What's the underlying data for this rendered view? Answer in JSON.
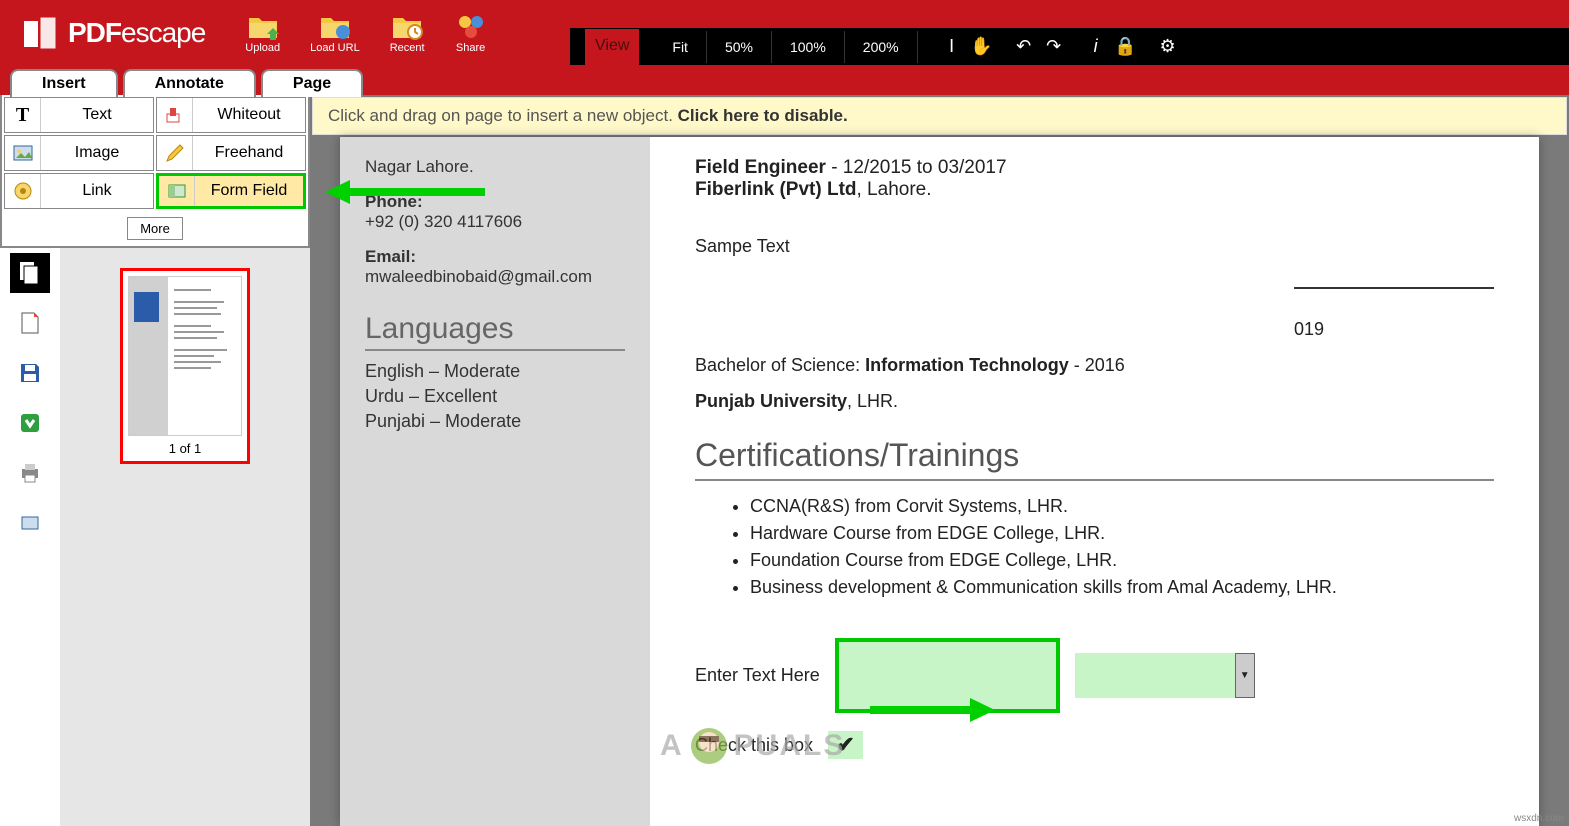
{
  "app": {
    "logo_text_bold": "PDF",
    "logo_text_light": "escape"
  },
  "topButtons": [
    {
      "label": "Upload",
      "icon": "folder-upload"
    },
    {
      "label": "Load URL",
      "icon": "folder-url"
    },
    {
      "label": "Recent",
      "icon": "folder-recent"
    },
    {
      "label": "Share",
      "icon": "share"
    }
  ],
  "viewBar": {
    "label": "View",
    "zoom": [
      "Fit",
      "50%",
      "100%",
      "200%"
    ]
  },
  "tabs": [
    "Insert",
    "Annotate",
    "Page"
  ],
  "tools": {
    "items": [
      {
        "label": "Text",
        "icon": "T"
      },
      {
        "label": "Whiteout",
        "icon": "whiteout"
      },
      {
        "label": "Image",
        "icon": "image"
      },
      {
        "label": "Freehand",
        "icon": "pencil"
      },
      {
        "label": "Link",
        "icon": "link"
      },
      {
        "label": "Form Field",
        "icon": "form",
        "highlighted": true
      }
    ],
    "more": "More"
  },
  "thumbnail": {
    "label": "1 of 1"
  },
  "hint": {
    "text": "Click and drag on page to insert a new object. ",
    "bold": "Click here to disable."
  },
  "document": {
    "leftCol": {
      "address": "Nagar Lahore.",
      "phoneLabel": "Phone:",
      "phone": "+92 (0) 320 4117606",
      "emailLabel": "Email:",
      "email": "mwaleedbinobaid@gmail.com",
      "langHeading": "Languages",
      "languages": [
        "English – Moderate",
        "Urdu – Excellent",
        "Punjabi – Moderate"
      ]
    },
    "rightCol": {
      "jobTitle": "Field Engineer",
      "jobDates": " - 12/2015 to 03/2017",
      "jobCompany": "Fiberlink (Pvt) Ltd",
      "jobLocation": ", Lahore.",
      "sample": "Sampe Text",
      "year": "019",
      "degreeLabel": "Bachelor of Science:  ",
      "degreeField": "Information Technology",
      "degreeYear": " - 2016",
      "degreeUni": "Punjab University",
      "degreeLoc": ", LHR.",
      "certHeading": "Certifications/Trainings",
      "certs": [
        "CCNA(R&S) from Corvit Systems, LHR.",
        "Hardware Course from EDGE College, LHR.",
        "Foundation Course from EDGE College, LHR.",
        "Business development & Communication skills from Amal Academy, LHR."
      ],
      "enterText": "Enter Text Here",
      "checkLabel": "Check this box"
    }
  },
  "watermark": "A  PUALS",
  "sourceTag": "wsxdn.com"
}
